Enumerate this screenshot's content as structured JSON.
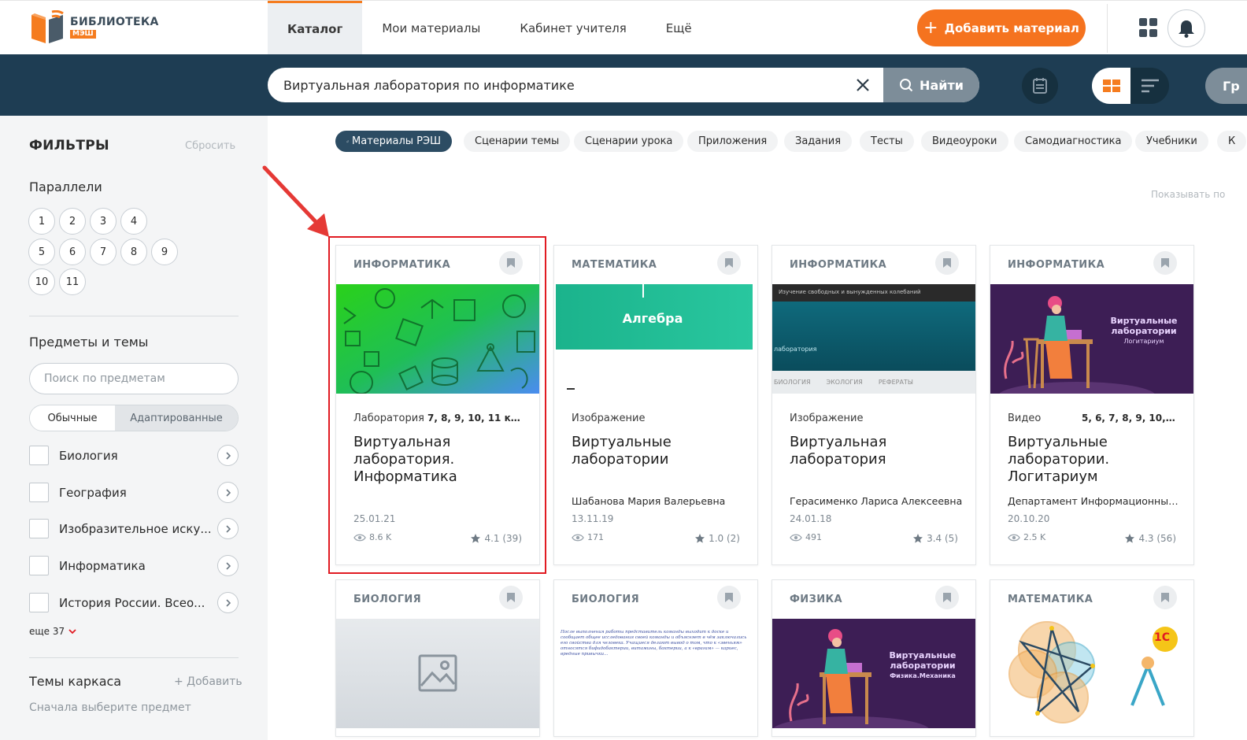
{
  "header": {
    "logo_title": "БИБЛИОТЕКА",
    "logo_sub": "МЭШ",
    "nav": [
      "Каталог",
      "Мои материалы",
      "Кабинет учителя",
      "Ещё"
    ],
    "add_button": "Добавить материал"
  },
  "search": {
    "value": "Виртуальная лаборатория по информатике",
    "find_label": "Найти",
    "group_label": "Гр"
  },
  "sidebar": {
    "filters_title": "ФИЛЬТРЫ",
    "reset": "Сбросить",
    "grades_title": "Параллели",
    "grades": [
      "1",
      "2",
      "3",
      "4",
      "5",
      "6",
      "7",
      "8",
      "9",
      "10",
      "11"
    ],
    "subjects_title": "Предметы и темы",
    "subject_search_placeholder": "Поиск по предметам",
    "segment_a": "Обычные",
    "segment_b": "Адаптированные",
    "subjects": [
      "Биология",
      "География",
      "Изобразительное иску...",
      "Информатика",
      "История России. Всео..."
    ],
    "more": "еще 37",
    "frame_title": "Темы каркаса",
    "add": "+ Добавить",
    "hint": "Сначала выберите предмет"
  },
  "chips": [
    "Материалы РЭШ",
    "Сценарии темы",
    "Сценарии урока",
    "Приложения",
    "Задания",
    "Тесты",
    "Видеоуроки",
    "Самодиагностика",
    "Учебники",
    "К"
  ],
  "show_by": "Показывать по",
  "cards": [
    {
      "subject": "ИНФОРМАТИКА",
      "type": "Лаборатория",
      "grades": "7, 8, 9, 10, 11 кла...",
      "title": "Виртуальная лаборатория. Информатика",
      "author": "",
      "date": "25.01.21",
      "views": "8.6 K",
      "rating": "4.1 (39)"
    },
    {
      "subject": "МАТЕМАТИКА",
      "type": "Изображение",
      "grades": "",
      "title": "Виртуальные лаборатории",
      "author": "Шабанова Мария Валерьевна",
      "date": "13.11.19",
      "views": "171",
      "rating": "1.0 (2)",
      "thumb_text": "Алгебра"
    },
    {
      "subject": "ИНФОРМАТИКА",
      "type": "Изображение",
      "grades": "",
      "title": "Виртуальная лаборатория",
      "author": "Герасименко Лариса Алексеевна",
      "date": "24.01.18",
      "views": "491",
      "rating": "3.4 (5)",
      "thumb_text": [
        "Изучение свободных и вынужденных колебаний",
        "лаборатория",
        "БИОЛОГИЯ",
        "ЭКОЛОГИЯ",
        "РЕФЕРАТЫ"
      ]
    },
    {
      "subject": "ИНФОРМАТИКА",
      "type": "Видео",
      "grades": "5, 6, 7, 8, 9, 10, 11...",
      "title": "Виртуальные лаборатории. Логитариум",
      "author": "Департамент Информационных...",
      "date": "20.10.20",
      "views": "2.5 K",
      "rating": "4.3 (56)",
      "thumb_text": [
        "Виртуальные",
        "лаборатории",
        "Логитариум"
      ]
    },
    {
      "subject": "БИОЛОГИЯ"
    },
    {
      "subject": "БИОЛОГИЯ",
      "thumb_text": "После выполнения работы представитель команды выходит к доске и сообщает общее исследования своей команды и объясняет в чём заключались его свойства для человека. Учащиеся делают вывод о том, что к «звеньям» относятся бифидобактерии, витамины, бактерии, а к «врагам» — кариес, вредные привычки..."
    },
    {
      "subject": "ФИЗИКА",
      "thumb_text": [
        "Виртуальные",
        "лаборатории",
        "Физика.Механика"
      ]
    },
    {
      "subject": "МАТЕМАТИКА",
      "thumb_text": "1С"
    }
  ],
  "colors": {
    "brand_orange": "#f5731f",
    "band_navy": "#1e3d53",
    "highlight_red": "#e11b22"
  }
}
